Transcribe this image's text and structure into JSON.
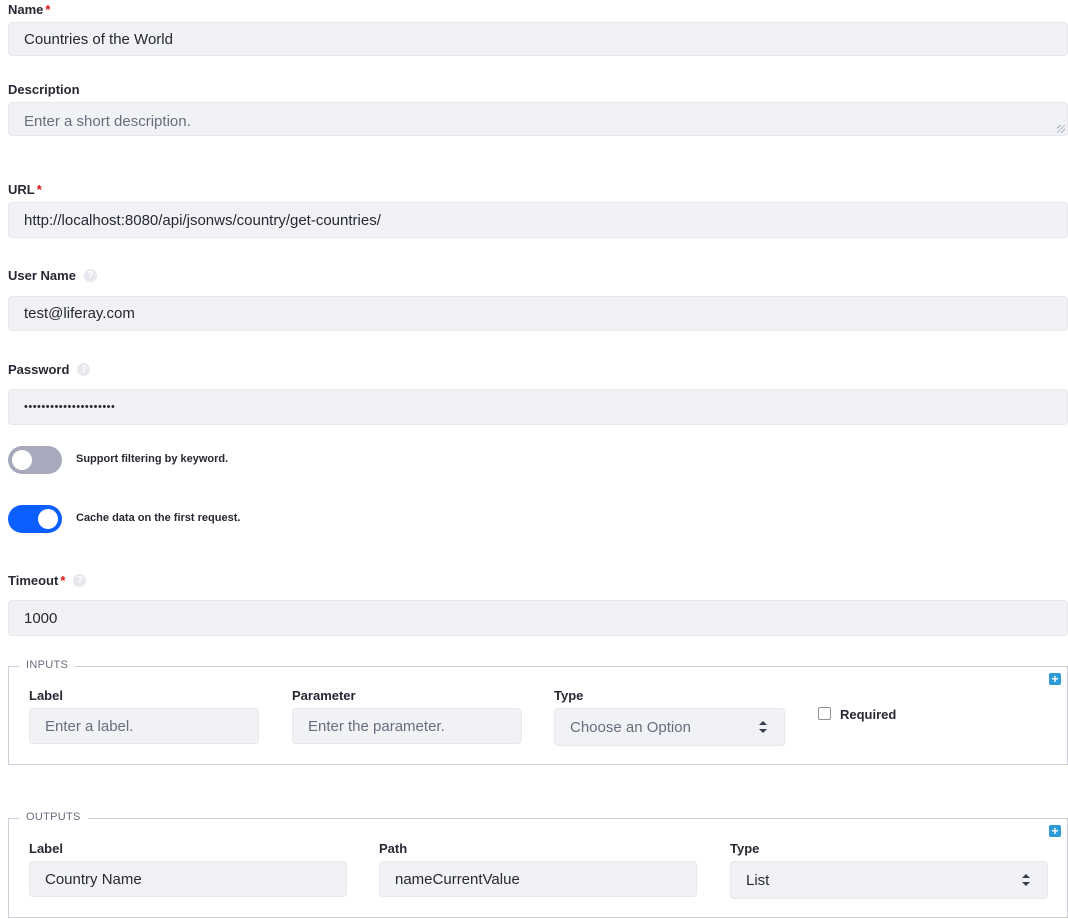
{
  "form": {
    "name": {
      "label": "Name",
      "required_mark": "*",
      "value": "Countries of the World"
    },
    "description": {
      "label": "Description",
      "placeholder": "Enter a short description."
    },
    "url": {
      "label": "URL",
      "required_mark": "*",
      "value": "http://localhost:8080/api/jsonws/country/get-countries/"
    },
    "username": {
      "label": "User Name",
      "help": "?",
      "value": "test@liferay.com"
    },
    "password": {
      "label": "Password",
      "help": "?",
      "value": "•••••••••••••••••••••"
    },
    "filter_toggle": {
      "label": "Support filtering by keyword.",
      "on": false
    },
    "cache_toggle": {
      "label": "Cache data on the first request.",
      "on": true
    },
    "timeout": {
      "label": "Timeout",
      "required_mark": "*",
      "help": "?",
      "value": "1000"
    }
  },
  "inputs": {
    "legend": "INPUTS",
    "add_icon": "plus-icon",
    "label_header": "Label",
    "label_placeholder": "Enter a label.",
    "parameter_header": "Parameter",
    "parameter_placeholder": "Enter the parameter.",
    "type_header": "Type",
    "type_placeholder": "Choose an Option",
    "required_label": "Required",
    "required_checked": false
  },
  "outputs": {
    "legend": "OUTPUTS",
    "add_icon": "plus-icon",
    "label_header": "Label",
    "label_value": "Country Name",
    "path_header": "Path",
    "path_value": "nameCurrentValue",
    "type_header": "Type",
    "type_value": "List"
  },
  "colors": {
    "accent": "#0b5fff",
    "toggle_off": "#a7a9bc",
    "required": "#da1414",
    "add_button": "#2e9ad6"
  }
}
